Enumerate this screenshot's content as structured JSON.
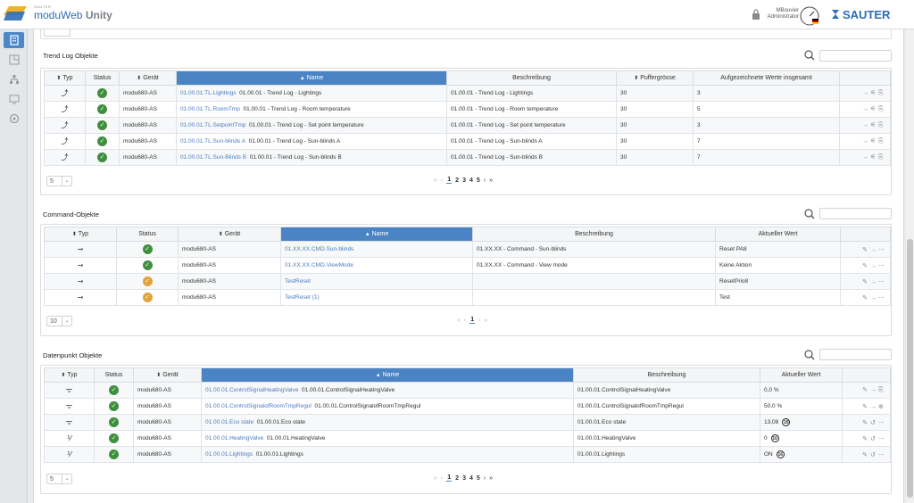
{
  "header": {
    "brand_small": "SAUTER",
    "brand_name": "moduWeb",
    "brand_suffix": "Unity",
    "user_name": "MBouvier",
    "user_role": "Administrator",
    "company_logo": "SAUTER"
  },
  "colors": {
    "accent": "#4a84c4",
    "ok": "#3f8f3f",
    "warn": "#e0a43a",
    "link": "#4a7cc0"
  },
  "sidebar": {
    "items": [
      {
        "icon": "building-icon",
        "active": true
      },
      {
        "icon": "floorplan-icon",
        "active": false
      },
      {
        "icon": "network-icon",
        "active": false
      },
      {
        "icon": "devices-icon",
        "active": false
      },
      {
        "icon": "settings-icon",
        "active": false
      }
    ]
  },
  "trend": {
    "title": "Trend Log Objekte",
    "search_placeholder": "",
    "headers": [
      "Typ",
      "Status",
      "Gerät",
      "Name",
      "Beschreibung",
      "Puffergrösse",
      "Aufgezeichnete Werte insgesamt"
    ],
    "rows": [
      {
        "device": "modu680-AS",
        "name_link": "01.00.01.TL.Lightings",
        "name_text": "01.00.01 - Trend Log - Lightings",
        "desc": "01.00.01 - Trend Log - Lightings",
        "buffer": "30",
        "recorded": "3"
      },
      {
        "device": "modu680-AS",
        "name_link": "01.00.01.TL.RoomTmp",
        "name_text": "01.00.01 - Trend Log - Room temperature",
        "desc": "01.00.01 - Trend Log - Room temperature",
        "buffer": "30",
        "recorded": "5"
      },
      {
        "device": "modu680-AS",
        "name_link": "01.00.01.TL.SetpointTmp",
        "name_text": "01.00.01 - Trend Log - Set point temperature",
        "desc": "01.00.01 - Trend Log - Set point temperature",
        "buffer": "30",
        "recorded": "3"
      },
      {
        "device": "modu680-AS",
        "name_link": "01.00.01.TL.Sun-blinds A",
        "name_text": "01.00.01 - Trend Log - Sun-blinds A",
        "desc": "01.00.01 - Trend Log - Sun-blinds A",
        "buffer": "30",
        "recorded": "7"
      },
      {
        "device": "modu680-AS",
        "name_link": "01.00.01.TL.Sun-Blinds B",
        "name_text": "01.00.01 - Trend Log - Sun-blinds B",
        "desc": "01.00.01 - Trend Log - Sun-blinds B",
        "buffer": "30",
        "recorded": "7"
      }
    ],
    "page_size": "5",
    "pages": [
      "1",
      "2",
      "3",
      "4",
      "5"
    ]
  },
  "command": {
    "title": "Command-Objekte",
    "headers": [
      "Typ",
      "Status",
      "Gerät",
      "Name",
      "Beschreibung",
      "Aktueller Wert"
    ],
    "rows": [
      {
        "device": "modu680-AS",
        "name": "01.XX.XX.CMD.Sun-blinds",
        "desc": "01.XX.XX - Command - Sun-blinds",
        "value": "Reset PA8",
        "status": "ok"
      },
      {
        "device": "modu680-AS",
        "name": "01.XX.XX.CMD.ViewMode",
        "desc": "01.XX.XX - Command - View mode",
        "value": "Keine Aktion",
        "status": "ok"
      },
      {
        "device": "modu680-AS",
        "name": "TestReset",
        "desc": "",
        "value": "ResetPrio8",
        "status": "warn"
      },
      {
        "device": "modu680-AS",
        "name": "TestReset (1)",
        "desc": "",
        "value": "Test",
        "status": "warn"
      }
    ],
    "page_size": "10",
    "pages": [
      "1"
    ]
  },
  "datapoint": {
    "title": "Datenpunkt Objekte",
    "headers": [
      "Typ",
      "Status",
      "Gerät",
      "Name",
      "Beschreibung",
      "Aktueller Wert"
    ],
    "rows": [
      {
        "type": "analog",
        "device": "modu680-AS",
        "name_link": "01.00.01.ControlSignalHeatingValve",
        "name_text": "01.00.01.ControlSignalHeatingValve",
        "desc": "01.00.01.ControlSignalHeatingValve",
        "value": "0,0 %",
        "badge": ""
      },
      {
        "type": "analog",
        "device": "modu680-AS",
        "name_link": "01.00.01.ControlSignalofRoomTmpRegul",
        "name_text": "01.00.01.ControlSignalofRoomTmpRegul",
        "desc": "01.00.01.ControlSignalofRoomTmpRegul",
        "value": "50,0 %",
        "badge": ""
      },
      {
        "type": "analog",
        "device": "modu680-AS",
        "name_link": "01.00.01.Eco state",
        "name_text": "01.00.01.Eco state",
        "desc": "01.00.01.Eco state",
        "value": "13,08",
        "badge": "16"
      },
      {
        "type": "binary",
        "device": "modu680-AS",
        "name_link": "01.00.01.HeatingValve",
        "name_text": "01.00.01.HeatingValve",
        "desc": "01.00.01.HeatingValve",
        "value": "0",
        "badge": "16"
      },
      {
        "type": "binary",
        "device": "modu680-AS",
        "name_link": "01.00.01.Lightings",
        "name_text": "01.00.01.Lightings",
        "desc": "01.00.01.Lightings",
        "value": "ON",
        "badge": "16"
      }
    ],
    "page_size": "5",
    "pages": [
      "1",
      "2",
      "3",
      "4",
      "5"
    ]
  }
}
